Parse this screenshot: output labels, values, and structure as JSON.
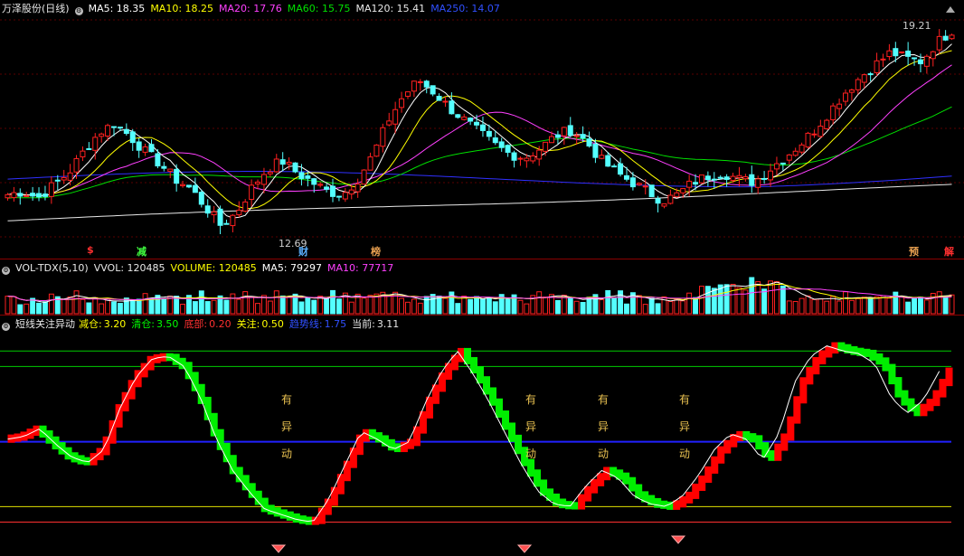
{
  "price_header": {
    "title": "万泽股份(日线)",
    "ma5": "MA5: 18.35",
    "ma10": "MA10: 18.25",
    "ma20": "MA20: 17.76",
    "ma60": "MA60: 15.75",
    "ma120": "MA120: 15.41",
    "ma250": "MA250: 14.07"
  },
  "price_labels": {
    "high": "19.21",
    "low": "12.69"
  },
  "event_tags": [
    "$",
    "减",
    "财",
    "榜",
    "预",
    "解"
  ],
  "volume_header": {
    "title": "VOL-TDX(5,10)",
    "vvol": "VVOL: 120485",
    "volume": "VOLUME: 120485",
    "ma5": "MA5: 79297",
    "ma10": "MA10: 77717"
  },
  "osc_header": {
    "title": "短线关注异动",
    "v1_label": "减仓:",
    "v1": "3.20",
    "v2_label": "清仓:",
    "v2": "3.50",
    "v3_label": "底部:",
    "v3": "0.20",
    "v4_label": "关注:",
    "v4": "0.50",
    "v5_label": "趋势线:",
    "v5": "1.75",
    "v6_label": "当前:",
    "v6": "3.11"
  },
  "signal_text": [
    "有",
    "异",
    "动"
  ],
  "colors": {
    "up": "#ff2020",
    "down": "#54ffff",
    "ma5": "#ffffff",
    "ma10": "#ffff00",
    "ma20": "#ff40ff",
    "ma60": "#00e000",
    "ma120": "#e8e8e8",
    "ma250": "#3030ff",
    "osc_up": "#ff0000",
    "osc_down": "#00ee00"
  },
  "chart_data": {
    "type": "candlestick",
    "price_range": [
      12.69,
      19.21
    ],
    "close_series": [
      13.9,
      14.0,
      13.8,
      14.2,
      14.6,
      15.3,
      15.9,
      16.2,
      15.8,
      15.3,
      14.9,
      14.4,
      14.1,
      13.5,
      12.9,
      13.3,
      14.1,
      14.7,
      15.0,
      14.6,
      14.3,
      14.0,
      13.9,
      14.4,
      15.2,
      16.3,
      17.1,
      17.6,
      17.2,
      16.7,
      16.3,
      15.9,
      15.5,
      15.2,
      15.1,
      15.4,
      15.8,
      16.0,
      15.6,
      15.0,
      14.6,
      14.3,
      14.0,
      13.7,
      13.9,
      14.3,
      14.5,
      14.6,
      14.4,
      14.3,
      14.7,
      15.1,
      15.5,
      16.0,
      16.6,
      17.2,
      17.7,
      18.1,
      18.5,
      18.3,
      18.2,
      18.8,
      19.2
    ],
    "oscillator_series": [
      1.8,
      1.85,
      2.0,
      1.7,
      1.45,
      1.35,
      1.6,
      2.4,
      3.0,
      3.35,
      3.4,
      3.2,
      2.6,
      1.8,
      1.2,
      0.8,
      0.45,
      0.35,
      0.25,
      0.2,
      0.65,
      1.3,
      1.95,
      1.8,
      1.6,
      1.75,
      2.5,
      3.1,
      3.5,
      3.05,
      2.5,
      1.9,
      1.3,
      0.8,
      0.55,
      0.5,
      0.9,
      1.2,
      1.05,
      0.7,
      0.55,
      0.5,
      0.7,
      1.1,
      1.6,
      1.9,
      1.8,
      1.4,
      1.9,
      2.9,
      3.4,
      3.6,
      3.5,
      3.45,
      3.25,
      2.6,
      2.3,
      2.55,
      3.11
    ],
    "horizontal_lines": [
      {
        "value": 3.5,
        "color": "#00cc00"
      },
      {
        "value": 3.2,
        "color": "#00cc00"
      },
      {
        "value": 1.75,
        "color": "#2020ff"
      },
      {
        "value": 0.5,
        "color": "#e0e000"
      },
      {
        "value": 0.2,
        "color": "#ff3030"
      }
    ]
  }
}
